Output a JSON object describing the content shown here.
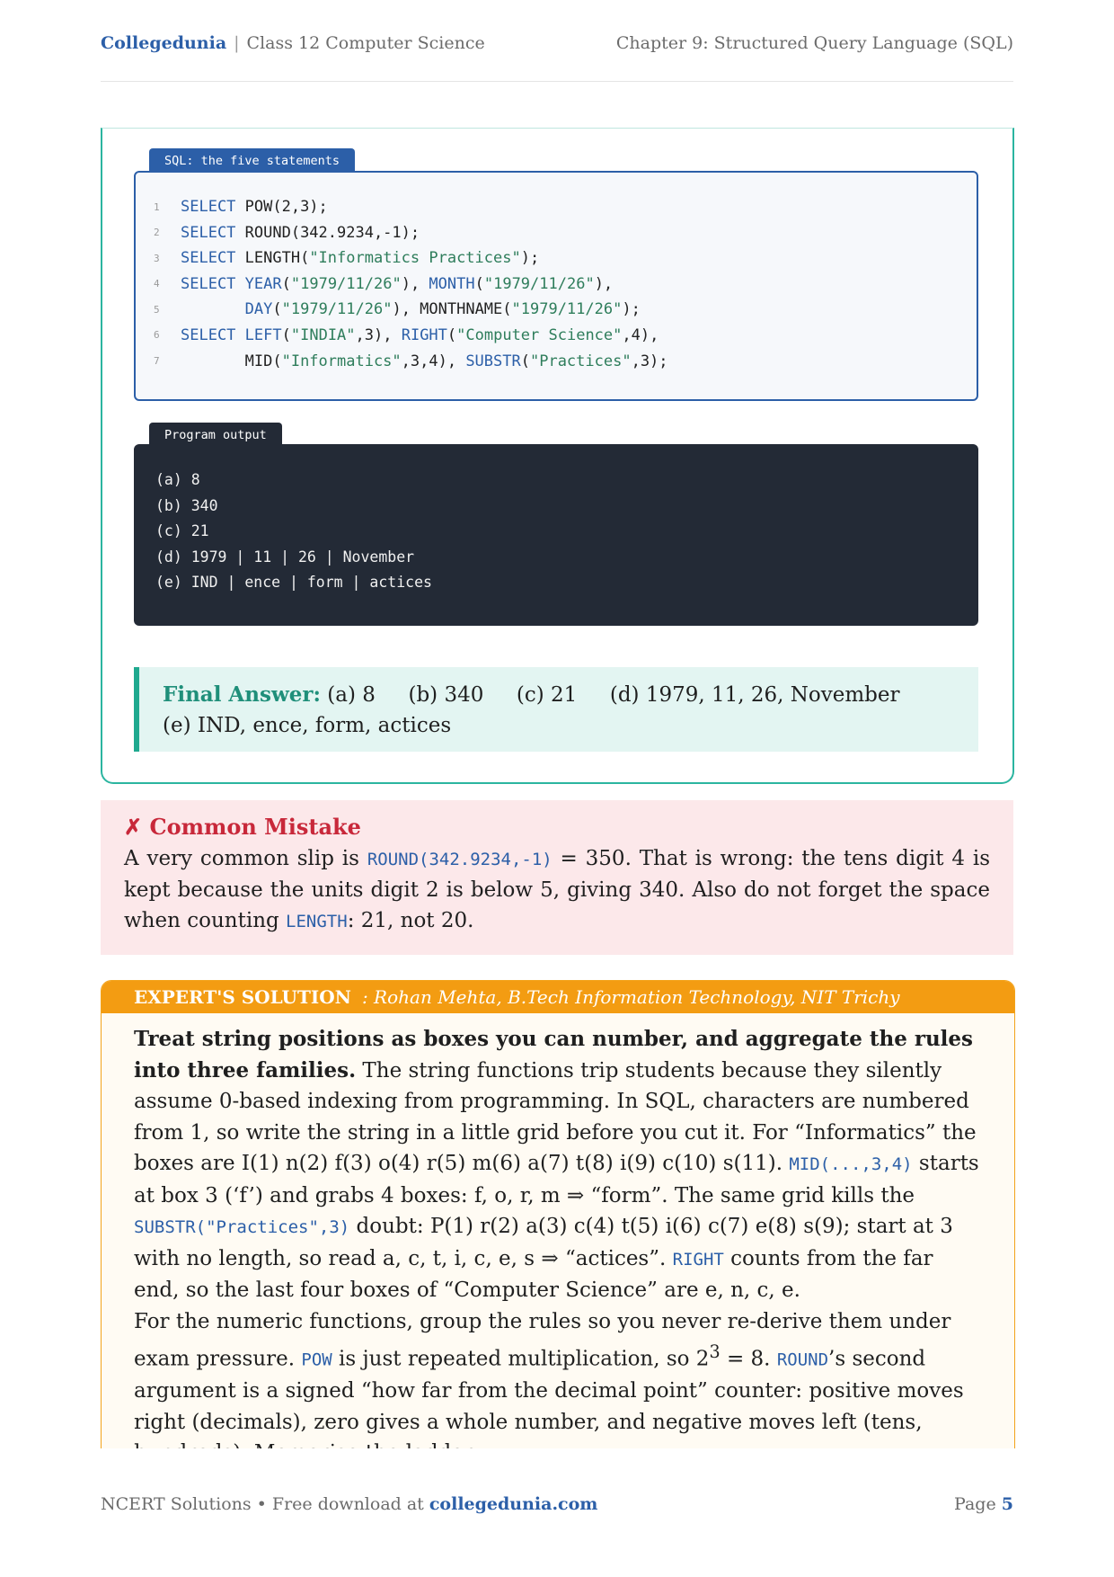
{
  "header": {
    "brand": "Collegedunia",
    "separator": "|",
    "course": "Class 12 Computer Science",
    "chapter": "Chapter 9: Structured Query Language (SQL)"
  },
  "code_panel": {
    "title": "SQL: the five statements",
    "lines": [
      {
        "num": "1",
        "text": ""
      },
      {
        "num": "2",
        "text": ""
      },
      {
        "num": "3",
        "text": ""
      },
      {
        "num": "4",
        "text": ""
      },
      {
        "num": "5",
        "text": ""
      },
      {
        "num": "6",
        "text": ""
      },
      {
        "num": "7",
        "text": ""
      }
    ]
  },
  "output_panel": {
    "title": "Program output",
    "lines": [
      "(a) 8",
      "(b) 340",
      "(c) 21",
      "(d) 1979 | 11 | 26 | November",
      "(e) IND | ence | form | actices"
    ]
  },
  "final_answer": {
    "label": "Final Answer:",
    "text": " (a) 8     (b) 340     (c) 21     (d) 1979, 11, 26, November     (e) IND, ence, form, actices"
  },
  "common_mistake": {
    "title": "✗ Common Mistake",
    "t1": "A very common slip is ",
    "c1": "ROUND(342.9234,-1)",
    "t2": " = 350. That is wrong: the tens digit 4 is kept because the units digit 2 is below 5, giving 340. Also do not forget the space when counting ",
    "c2": "LENGTH",
    "t3": ": 21, not 20."
  },
  "expert": {
    "label": "EXPERT'S SOLUTION",
    "author": ": Rohan Mehta, B.Tech Information Technology, NIT Trichy",
    "p1_bold": "Treat string positions as boxes you can number, and aggregate the rules into three families.",
    "p1_a": " The string functions trip students because they silently assume 0-based indexing from programming. In SQL, characters are numbered from 1, so write the string in a little grid before you cut it. For “Informatics” the boxes are I(1) n(2) f(3) o(4) r(5) m(6) a(7) t(8) i(9) c(10) s(11). ",
    "p1_c1": "MID(...,3,4)",
    "p1_b": " starts at box 3 (‘f’) and grabs 4 boxes: f, o, r, m ⇒ “form”. The same grid kills the ",
    "p1_c2": "SUBSTR(\"Practices\",3)",
    "p1_c": " doubt: P(1) r(2) a(3) c(4) t(5) i(6) c(7) e(8) s(9); start at 3 with no length, so read a, c, t, i, c, e, s ⇒ “actices”. ",
    "p1_c3": "RIGHT",
    "p1_d": " counts from the far end, so the last four boxes of “Computer Science” are e, n, c, e.",
    "p2_a": "For the numeric functions, group the rules so you never re-derive them under exam pressure. ",
    "p2_c1": "POW",
    "p2_b": " is just repeated multiplication, so 2",
    "p2_sup": "3",
    "p2_c": " = 8. ",
    "p2_c2": "ROUND",
    "p2_d": "’s second argument is a signed “how far from the decimal point” counter: positive moves right (decimals), zero gives a whole number, and negative moves left (tens, hundreds). Memorise the ladder"
  },
  "footer": {
    "left": "NCERT Solutions • Free download at ",
    "url": "collegedunia.com",
    "page_label": "Page ",
    "page_num": "5"
  }
}
